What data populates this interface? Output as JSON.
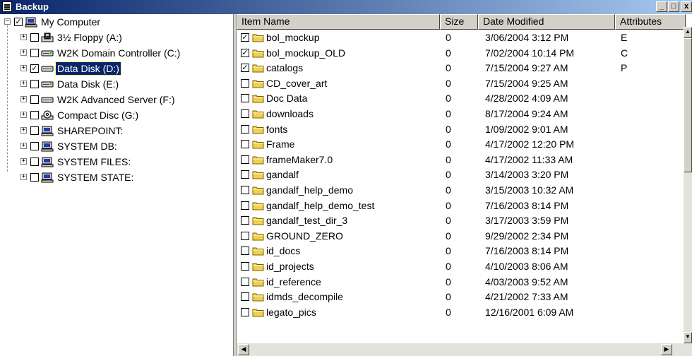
{
  "window": {
    "title": "Backup"
  },
  "titlebar_buttons": {
    "minimize": "_",
    "maximize": "□",
    "close": "x"
  },
  "tree": {
    "root": {
      "label": "My Computer",
      "checked": true,
      "expander": "−"
    },
    "items": [
      {
        "label": "3½ Floppy (A:)",
        "checked": false,
        "icon": "floppy-drive-icon"
      },
      {
        "label": "W2K Domain Controller (C:)",
        "checked": false,
        "icon": "hard-drive-icon"
      },
      {
        "label": "Data Disk (D:)",
        "checked": true,
        "selected": true,
        "icon": "hard-drive-icon"
      },
      {
        "label": "Data Disk (E:)",
        "checked": false,
        "icon": "hard-drive-icon"
      },
      {
        "label": "W2K Advanced Server (F:)",
        "checked": false,
        "icon": "hard-drive-icon"
      },
      {
        "label": "Compact Disc (G:)",
        "checked": false,
        "icon": "cd-drive-icon"
      },
      {
        "label": "SHAREPOINT:",
        "checked": false,
        "icon": "network-computer-icon"
      },
      {
        "label": "SYSTEM DB:",
        "checked": false,
        "icon": "network-computer-icon"
      },
      {
        "label": "SYSTEM FILES:",
        "checked": false,
        "icon": "network-computer-icon"
      },
      {
        "label": "SYSTEM STATE:",
        "checked": false,
        "icon": "network-computer-icon"
      }
    ]
  },
  "columns": [
    "Item Name",
    "Size",
    "Date Modified",
    "Attributes"
  ],
  "rows": [
    {
      "name": "bol_mockup",
      "size": "0",
      "date": "3/06/2004 3:12 PM",
      "attr": "E",
      "checked": true
    },
    {
      "name": "bol_mockup_OLD",
      "size": "0",
      "date": "7/02/2004 10:14 PM",
      "attr": "C",
      "checked": true
    },
    {
      "name": "catalogs",
      "size": "0",
      "date": "7/15/2004 9:27 AM",
      "attr": "P",
      "checked": true
    },
    {
      "name": "CD_cover_art",
      "size": "0",
      "date": "7/15/2004 9:25 AM",
      "attr": "",
      "checked": false
    },
    {
      "name": "Doc Data",
      "size": "0",
      "date": "4/28/2002 4:09 AM",
      "attr": "",
      "checked": false
    },
    {
      "name": "downloads",
      "size": "0",
      "date": "8/17/2004 9:24 AM",
      "attr": "",
      "checked": false
    },
    {
      "name": "fonts",
      "size": "0",
      "date": "1/09/2002 9:01 AM",
      "attr": "",
      "checked": false
    },
    {
      "name": "Frame",
      "size": "0",
      "date": "4/17/2002 12:20 PM",
      "attr": "",
      "checked": false
    },
    {
      "name": "frameMaker7.0",
      "size": "0",
      "date": "4/17/2002 11:33 AM",
      "attr": "",
      "checked": false
    },
    {
      "name": "gandalf",
      "size": "0",
      "date": "3/14/2003 3:20 PM",
      "attr": "",
      "checked": false
    },
    {
      "name": "gandalf_help_demo",
      "size": "0",
      "date": "3/15/2003 10:32 AM",
      "attr": "",
      "checked": false
    },
    {
      "name": "gandalf_help_demo_test",
      "size": "0",
      "date": "7/16/2003 8:14 PM",
      "attr": "",
      "checked": false
    },
    {
      "name": "gandalf_test_dir_3",
      "size": "0",
      "date": "3/17/2003 3:59 PM",
      "attr": "",
      "checked": false
    },
    {
      "name": "GROUND_ZERO",
      "size": "0",
      "date": "9/29/2002 2:34 PM",
      "attr": "",
      "checked": false
    },
    {
      "name": "id_docs",
      "size": "0",
      "date": "7/16/2003 8:14 PM",
      "attr": "",
      "checked": false
    },
    {
      "name": "id_projects",
      "size": "0",
      "date": "4/10/2003 8:06 AM",
      "attr": "",
      "checked": false
    },
    {
      "name": "id_reference",
      "size": "0",
      "date": "4/03/2003 9:52 AM",
      "attr": "",
      "checked": false
    },
    {
      "name": "idmds_decompile",
      "size": "0",
      "date": "4/21/2002 7:33 AM",
      "attr": "",
      "checked": false
    },
    {
      "name": "legato_pics",
      "size": "0",
      "date": "12/16/2001 6:09 AM",
      "attr": "",
      "checked": false
    }
  ]
}
